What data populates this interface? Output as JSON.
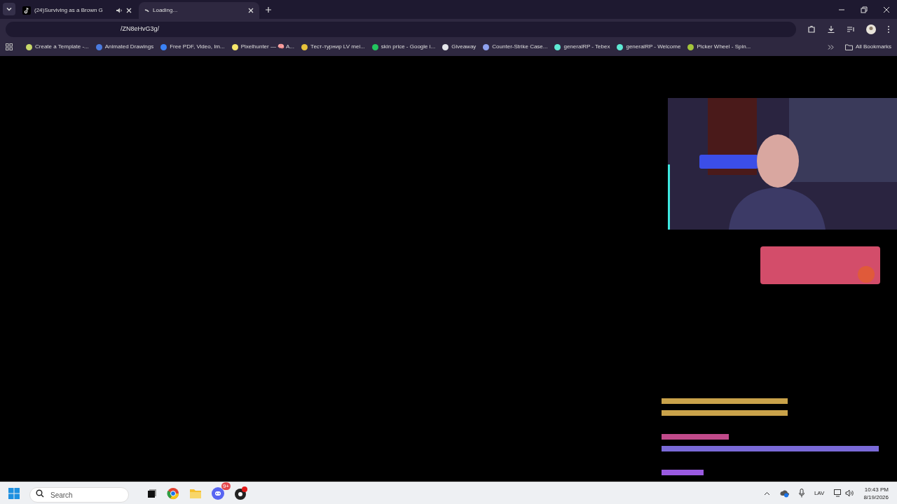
{
  "tabs": [
    {
      "label": "(24)Surviving as a Brown G",
      "selected": false,
      "kind": "media",
      "audio": true
    },
    {
      "label": "Loading...",
      "selected": true,
      "kind": "loading",
      "audio": false
    }
  ],
  "address": {
    "value": "/ZN8eHvG3g/"
  },
  "bookmarks": [
    {
      "label": "Create a Template -...",
      "color": "#c8d86a"
    },
    {
      "label": "Animated Drawings",
      "color": "#4a7be0"
    },
    {
      "label": "Free PDF, Video, Im...",
      "color": "#3b82f6"
    },
    {
      "label": "Pixelhunter — 🧠 A...",
      "color": "#f5e66a"
    },
    {
      "label": "Тест-турнир LV mei...",
      "color": "#e8c23a"
    },
    {
      "label": "skin price - Google i...",
      "color": "#22c55e"
    },
    {
      "label": "Giveaway",
      "color": "#e5e7eb"
    },
    {
      "label": "Counter-Strike Case...",
      "color": "#8fa2f0"
    },
    {
      "label": "generalRP - Tebex",
      "color": "#5eead4"
    },
    {
      "label": "generalRP - Welcome",
      "color": "#5eead4"
    },
    {
      "label": "Picker Wheel - Spin...",
      "color": "#a3c43a"
    }
  ],
  "all_bookmarks": "All Bookmarks",
  "taskbar": {
    "search_placeholder": "Search",
    "discord_badge": "9+",
    "language": "LAV",
    "time": "10:43 PM",
    "date": "8/19/2026"
  }
}
